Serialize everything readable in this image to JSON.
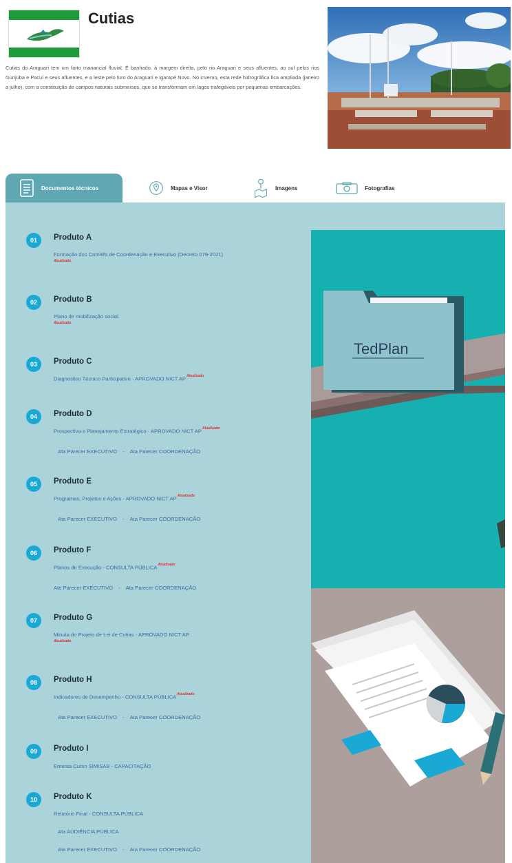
{
  "header": {
    "title": "Cutias",
    "description": "Cutias do Araguari tem um farto manancial fluvial. É banhado, à margem direita, pelo rio Araguari e seus afluentes, ao sul pelos rios Gurijuba e Pacuí e seus afluentes, e a leste pelo furo do Araguari e Igarapé Novo. No inverno, esta rede hidrográfica fica ampliada (janeiro a julho), com a constituição de campos naturais submersos, que se transformam em lagos trafegáveis por pequenas embarcações."
  },
  "tabs": [
    {
      "label": "Documentos técnicos",
      "icon": "document-icon",
      "active": true
    },
    {
      "label": "Mapas e Visor",
      "icon": "map-pin-icon",
      "active": false
    },
    {
      "label": "Imagens",
      "icon": "map-person-icon",
      "active": false
    },
    {
      "label": "Fotografias",
      "icon": "camera-icon",
      "active": false
    }
  ],
  "illustration": {
    "logo_text": "TedPlan"
  },
  "products": [
    {
      "num": "01",
      "name": "Produto A",
      "desc": "Formação dos Comitês de Coordenação e Executivo (Decreto 079-2021)",
      "updated": "Atualizado"
    },
    {
      "num": "02",
      "name": "Produto B",
      "desc": "Plano de mobilização social.",
      "updated": "Atualizado"
    },
    {
      "num": "03",
      "name": "Produto C",
      "desc": "Diagnostico Técnico Participativo - APROVADO NICT AP",
      "updated": "Atualizado"
    },
    {
      "num": "04",
      "name": "Produto D",
      "desc": "Prospectiva e Planejamento Estratégico - APROVADO NICT AP",
      "updated": "Atualizado",
      "link1": "Ata Parecer EXECUTIVO",
      "sep": "-",
      "link2": "Ata Parecer COORDENAÇÃO"
    },
    {
      "num": "05",
      "name": "Produto E",
      "desc": "Programas, Projetos e Ações - APROVADO NICT AP",
      "updated": "Atualizado",
      "link1": "Ata Parecer EXECUTIVO",
      "sep": "-",
      "link2": "Ata Parecer COORDENAÇÃO"
    },
    {
      "num": "06",
      "name": "Produto F",
      "desc": "Planos de Execução - CONSULTA PÚBLICA",
      "updated": "Atualizado",
      "link1": "Ata Parecer EXECUTIVO",
      "sep": "-",
      "link2": "Ata Parecer COORDENAÇÃO"
    },
    {
      "num": "07",
      "name": "Produto G",
      "desc": "Minuta do Projeto de Lei de Cutias - APROVADO NICT AP",
      "updated": "Atualizado"
    },
    {
      "num": "08",
      "name": "Produto H",
      "desc": "Indicadores de Desempenho - CONSULTA PÚBLICA",
      "updated": "Atualizado",
      "link1": "Ata Parecer EXECUTIVO",
      "sep": "-",
      "link2": "Ata Parecer COORDENAÇÃO"
    },
    {
      "num": "09",
      "name": "Produto I",
      "desc": "Ementa Curso SIMISAB - CAPACITAÇÃO"
    },
    {
      "num": "10",
      "name": "Produto K",
      "desc": "Relatório Final - CONSULTA PÚBLICA",
      "audiencia": "Ata AUDIÊNCIA PÚBLICA",
      "link1": "Ata Parecer EXECUTIVO",
      "sep": "-",
      "link2": "Ata Parecer COORDENAÇÃO"
    }
  ],
  "colors": {
    "flag_green": "#1e9b3a",
    "tab_active": "#5fa7b2",
    "panel_bg": "#abd3da",
    "badge": "#19a9d4",
    "updated_red": "#e52b2b",
    "link_blue": "#3d6aa0",
    "illus_teal": "#16b0b0"
  }
}
